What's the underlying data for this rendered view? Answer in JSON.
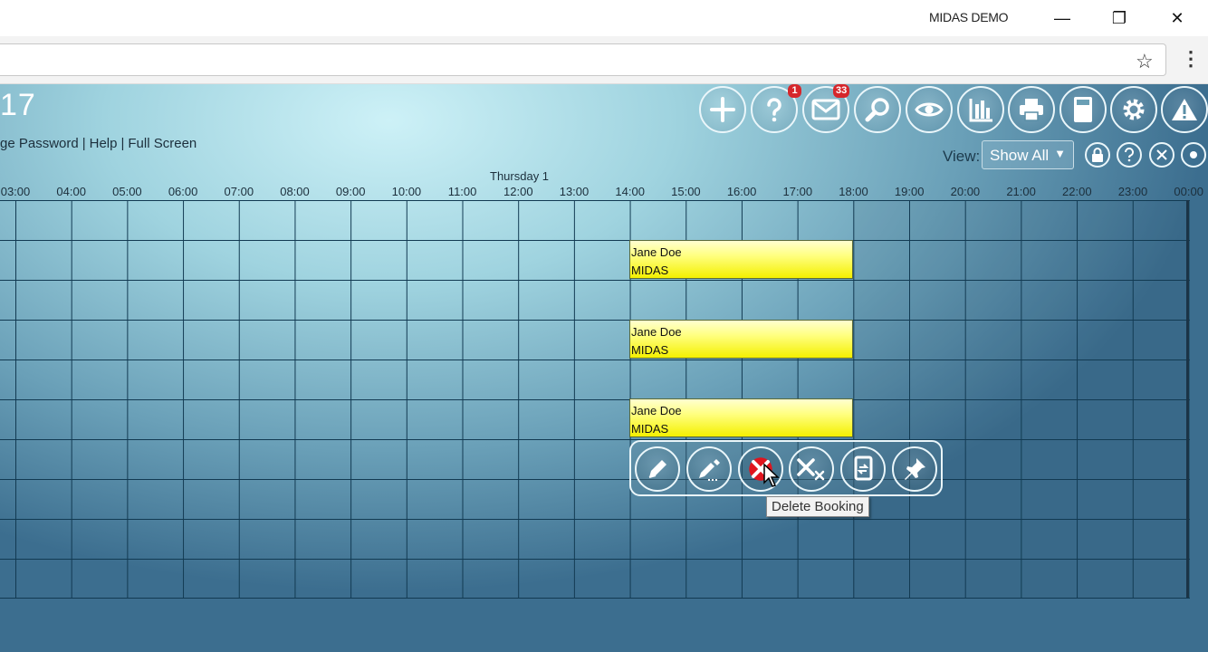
{
  "window": {
    "title": "MIDAS DEMO",
    "minimize": "—",
    "restore": "❐",
    "close": "✕"
  },
  "browser": {
    "star": "☆",
    "menu": "⋮"
  },
  "app": {
    "title": "17",
    "links": [
      "ge Password",
      "Help",
      "Full Screen"
    ],
    "link_separator": "|",
    "badges": {
      "help": "1",
      "messages": "33"
    },
    "view_label": "View:",
    "view_value": "Show All",
    "view_caret": "▼"
  },
  "schedule": {
    "day_label": "Thursday 1",
    "hours": [
      "03:00",
      "04:00",
      "05:00",
      "06:00",
      "07:00",
      "08:00",
      "09:00",
      "10:00",
      "11:00",
      "12:00",
      "13:00",
      "14:00",
      "15:00",
      "16:00",
      "17:00",
      "18:00",
      "19:00",
      "20:00",
      "21:00",
      "22:00",
      "23:00",
      "00:00"
    ],
    "bookings": [
      {
        "name": "Jane Doe",
        "org": "MIDAS"
      },
      {
        "name": "Jane Doe",
        "org": "MIDAS"
      },
      {
        "name": "Jane Doe",
        "org": "MIDAS"
      }
    ]
  },
  "tooltip": "Delete Booking",
  "colors": {
    "booking": "#ffff80",
    "badge": "#d6262b",
    "delete": "#e0141e"
  }
}
